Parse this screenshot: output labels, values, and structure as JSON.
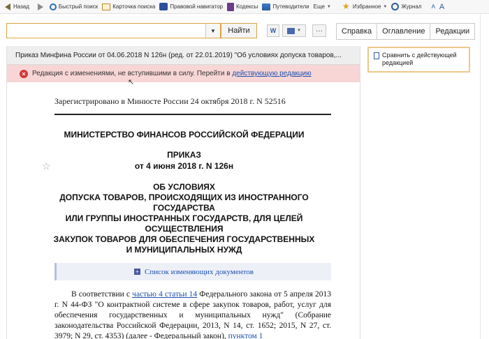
{
  "toolbar": {
    "back": "Назад",
    "quick_search": "Быстрый поиск",
    "search_card": "Карточка поиска",
    "legal_navigator": "Правовой навигатор",
    "codes": "Кодексы",
    "guides": "Путеводители",
    "more": "Еще",
    "favorites": "Избранное",
    "journal": "Журнал",
    "font_small": "A",
    "font_large": "A"
  },
  "search": {
    "value": "",
    "placeholder": "",
    "find_label": "Найти",
    "dropdown_caret": "▼",
    "w_label": "W",
    "more_label": "···"
  },
  "tabs": [
    "Справка",
    "Оглавление",
    "Редакции"
  ],
  "document": {
    "title": "Приказ Минфина России от 04.06.2018 N 126н (ред. от 22.01.2019) \"Об условиях допуска товаров,...",
    "warning_text": "Редакция с изменениями, не вступившими в силу. Перейти в ",
    "warning_link": "действующую редакцию",
    "registered": "Зарегистрировано в Минюсте России 24 октября 2018 г. N 52516",
    "ministry": "МИНИСТЕРСТВО ФИНАНСОВ РОССИЙСКОЙ ФЕДЕРАЦИИ",
    "order": "ПРИКАЗ",
    "order_date": "от 4 июня 2018 г. N 126н",
    "subject_lines": [
      "ОБ УСЛОВИЯХ",
      "ДОПУСКА ТОВАРОВ, ПРОИСХОДЯЩИХ ИЗ ИНОСТРАННОГО",
      "ГОСУДАРСТВА",
      "ИЛИ ГРУППЫ ИНОСТРАННЫХ ГОСУДАРСТВ, ДЛЯ ЦЕЛЕЙ",
      "ОСУЩЕСТВЛЕНИЯ",
      "ЗАКУПОК ТОВАРОВ ДЛЯ ОБЕСПЕЧЕНИЯ ГОСУДАРСТВЕННЫХ",
      "И МУНИЦИПАЛЬНЫХ НУЖД"
    ],
    "changes_list": "Список изменяющих документов",
    "para_prefix": "В соответствии с ",
    "para_link1": "частью 4 статьи 14",
    "para_body": " Федерального закона от 5 апреля 2013 г. N 44-ФЗ \"О контрактной системе в сфере закупок товаров, работ, услуг для обеспечения государственных и муниципальных нужд\" (Собрание законодательства Российской Федерации, 2013, N 14, ст. 1652; 2015, N 27, ст. 3979; N 29, ст. 4353) (далее - Федеральный закон), ",
    "para_link2": "пунктом 1"
  },
  "sidebar": {
    "compare_label": "Сравнить с действующей редакцией"
  },
  "colors": {
    "accent": "#d9a441",
    "warning_bg": "#f8d6d6",
    "link": "#1a4fb0"
  }
}
